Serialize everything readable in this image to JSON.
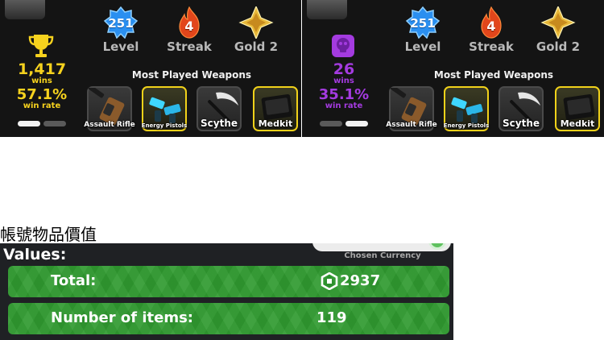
{
  "profiles": [
    {
      "level": "251",
      "level_label": "Level",
      "streak": "4",
      "streak_label": "Streak",
      "rank_label": "Gold 2",
      "wins": "1,417",
      "wins_label": "wins",
      "win_rate": "57.1%",
      "win_rate_label": "win rate",
      "wins_icon": "trophy-icon",
      "accent_color": "#f6d21e",
      "most_played_label": "Most Played Weapons",
      "active_page": 1,
      "weapons": [
        {
          "name": "Assault Rifle",
          "highlight": false
        },
        {
          "name": "Energy Pistols",
          "highlight": true
        },
        {
          "name": "Scythe",
          "highlight": false
        },
        {
          "name": "Medkit",
          "highlight": true
        }
      ]
    },
    {
      "level": "251",
      "level_label": "Level",
      "streak": "4",
      "streak_label": "Streak",
      "rank_label": "Gold 2",
      "wins": "26",
      "wins_label": "wins",
      "win_rate": "35.1%",
      "win_rate_label": "win rate",
      "wins_icon": "skull-badge-icon",
      "accent_color": "#a43be0",
      "most_played_label": "Most Played Weapons",
      "active_page": 2,
      "weapons": [
        {
          "name": "Assault Rifle",
          "highlight": false
        },
        {
          "name": "Energy Pistols",
          "highlight": true
        },
        {
          "name": "Scythe",
          "highlight": false
        },
        {
          "name": "Medkit",
          "highlight": true
        }
      ]
    }
  ],
  "section_heading": "帳號物品價值",
  "values": {
    "title": "Values:",
    "chosen_currency_label": "Chosen Currency",
    "total_label": "Total:",
    "total_value": "2937",
    "currency_icon": "robux-icon",
    "items_label": "Number of items:",
    "items_value": "119"
  },
  "colors": {
    "panel_bg": "#141414",
    "values_bg": "#1f2124",
    "row_green": "#2f9a2f",
    "level_blue": "#2a8ff0",
    "streak_orange": "#e2461b",
    "rank_gold": "#e8b93a",
    "card_gold_border": "#f1d21a"
  }
}
